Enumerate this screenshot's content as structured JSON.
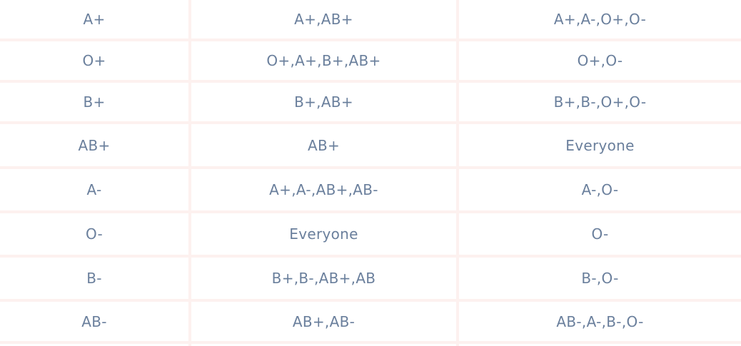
{
  "rows": [
    {
      "blood_type": "A+",
      "can_donate_to": "A+,AB+",
      "can_receive_from": "A+,A-,O+,O-"
    },
    {
      "blood_type": "O+",
      "can_donate_to": "O+,A+,B+,AB+",
      "can_receive_from": "O+,O-"
    },
    {
      "blood_type": "B+",
      "can_donate_to": "B+,AB+",
      "can_receive_from": "B+,B-,O+,O-"
    },
    {
      "blood_type": "AB+",
      "can_donate_to": "AB+",
      "can_receive_from": "Everyone"
    },
    {
      "blood_type": "A-",
      "can_donate_to": "A+,A-,AB+,AB-",
      "can_receive_from": "A-,O-"
    },
    {
      "blood_type": "O-",
      "can_donate_to": "Everyone",
      "can_receive_from": "O-"
    },
    {
      "blood_type": "B-",
      "can_donate_to": "B+,B-,AB+,AB",
      "can_receive_from": "B-,O-"
    },
    {
      "blood_type": "AB-",
      "can_donate_to": "AB+,AB-",
      "can_receive_from": "AB-,A-,B-,O-"
    }
  ]
}
